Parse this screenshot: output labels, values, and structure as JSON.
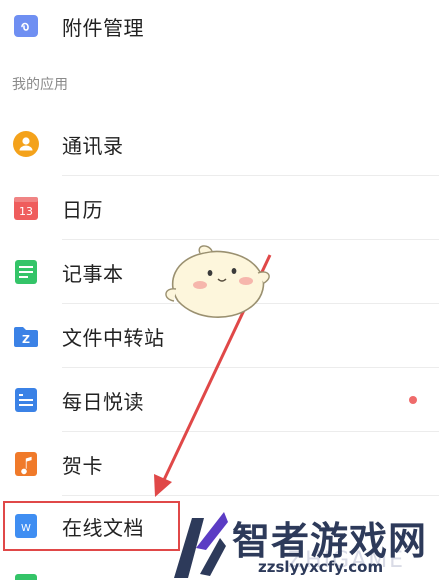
{
  "top_item": {
    "label": "附件管理",
    "icon": "attachment-icon",
    "color": "#6f8ff2"
  },
  "section_header": "我的应用",
  "apps": [
    {
      "label": "通讯录",
      "icon": "contacts-icon",
      "color": "#f4a21b"
    },
    {
      "label": "日历",
      "icon": "calendar-icon",
      "color": "#ef5d5d",
      "icon_text": "13"
    },
    {
      "label": "记事本",
      "icon": "notepad-icon",
      "color": "#34c468"
    },
    {
      "label": "文件中转站",
      "icon": "file-transfer-icon",
      "color": "#3b82e6",
      "icon_text": "Z"
    },
    {
      "label": "每日悦读",
      "icon": "daily-reading-icon",
      "color": "#3b82e6",
      "has_badge_dot": true
    },
    {
      "label": "贺卡",
      "icon": "greeting-card-icon",
      "color": "#f07a2a"
    },
    {
      "label": "在线文档",
      "icon": "online-doc-icon",
      "color": "#3f8ef2",
      "icon_text": "W",
      "highlighted": true
    }
  ],
  "watermark": {
    "title": "智者游戏网",
    "ghost": "ZHIGAME",
    "url": "zzslyyxcfy.com",
    "color": "#2d3a5a",
    "accent": "#5b3cc4"
  },
  "annotation": {
    "color": "#e04848"
  }
}
